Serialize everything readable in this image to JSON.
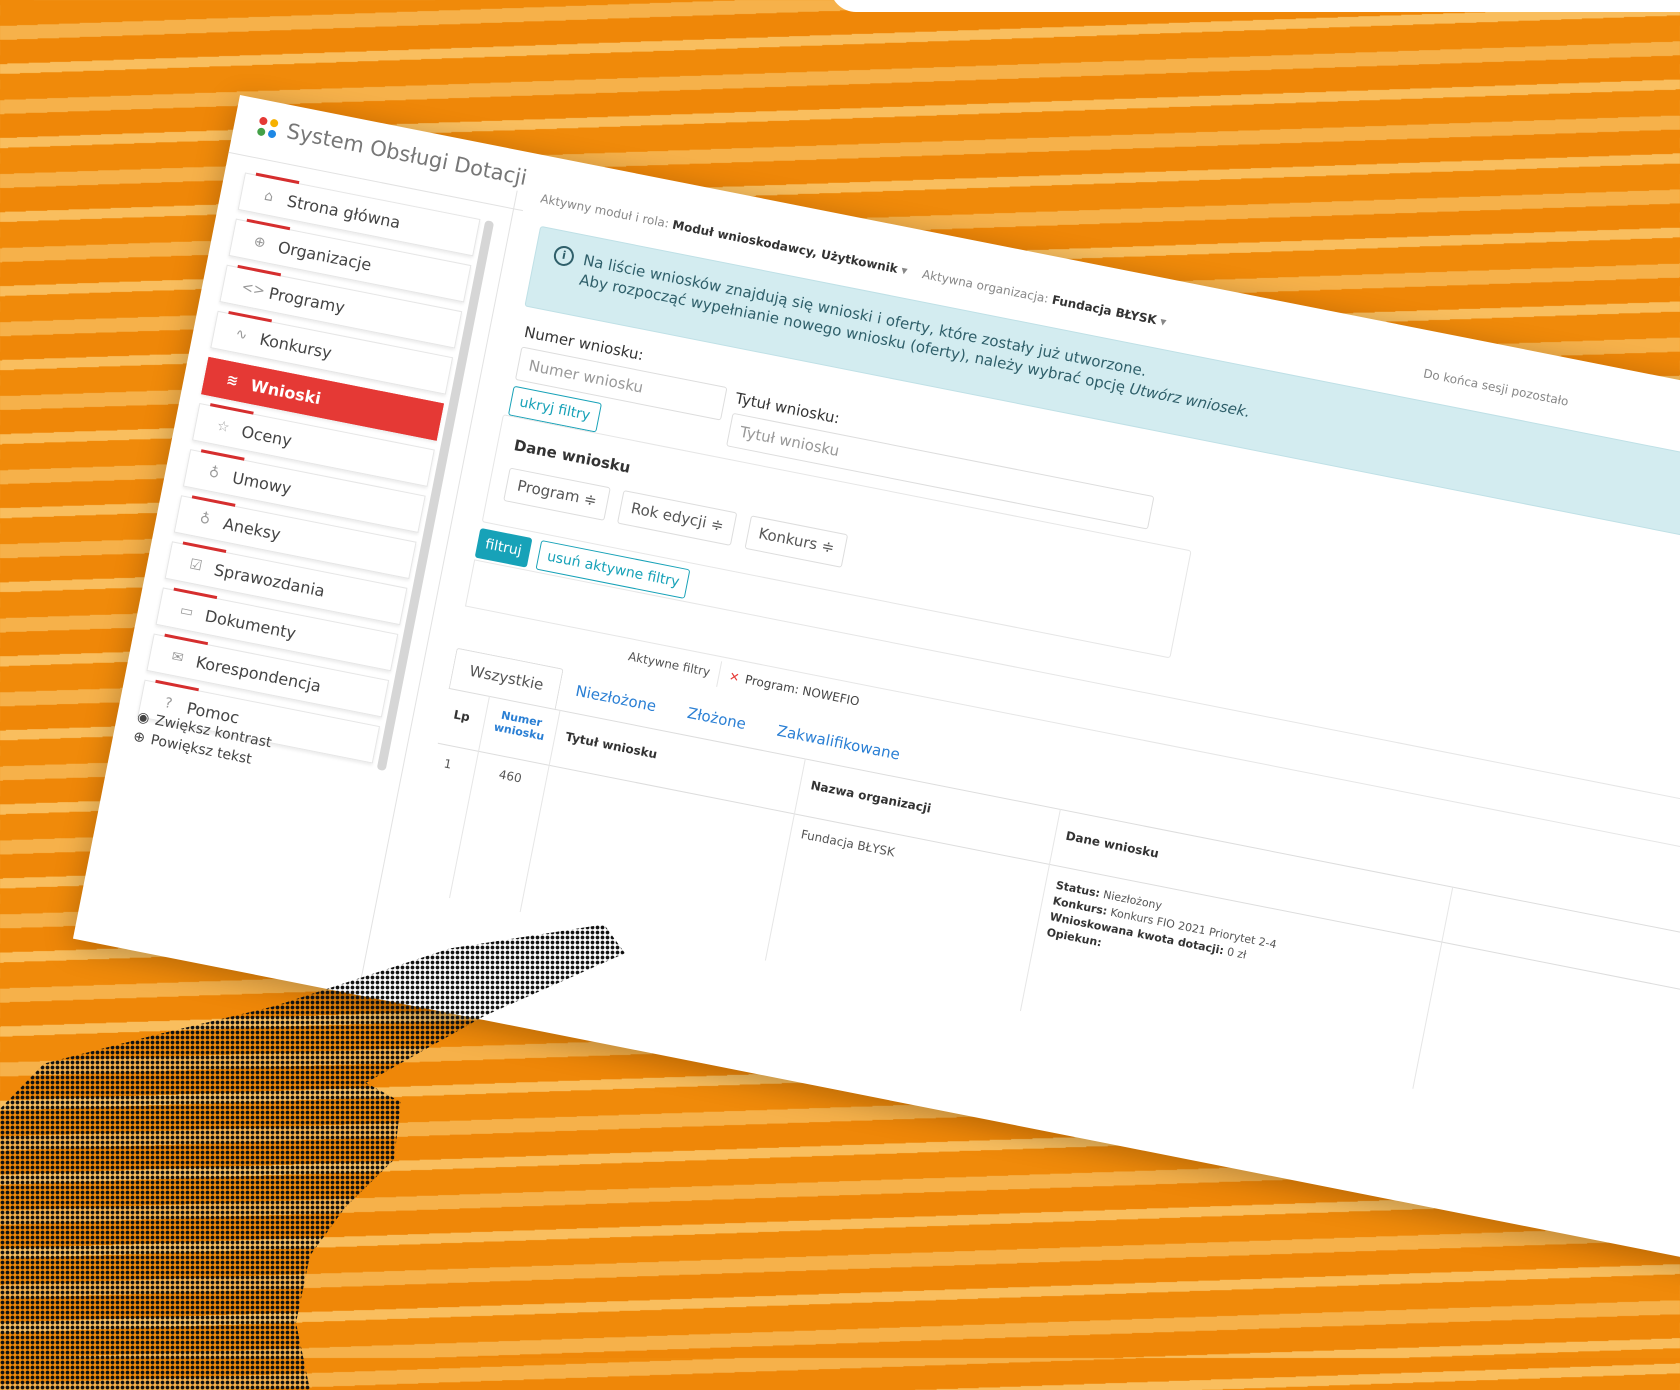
{
  "app": {
    "title": "System Obsługi Dotacji",
    "logo_colors": [
      "#e53935",
      "#f6b100",
      "#43a047",
      "#1e88e5"
    ]
  },
  "context": {
    "module_label": "Aktywny moduł i rola:",
    "module_value": "Moduł wnioskodawcy, Użytkownik",
    "org_label": "Aktywna organizacja:",
    "org_value": "Fundacja BŁYSK",
    "session_text": "Do końca sesji pozostało"
  },
  "sidebar": {
    "items": [
      {
        "label": "Strona główna",
        "icon": "home-icon",
        "glyph": "⌂"
      },
      {
        "label": "Organizacje",
        "icon": "globe-icon",
        "glyph": "⊕"
      },
      {
        "label": "Programy",
        "icon": "code-icon",
        "glyph": "<>"
      },
      {
        "label": "Konkursy",
        "icon": "pulse-icon",
        "glyph": "∿"
      },
      {
        "label": "Wnioski",
        "icon": "layers-icon",
        "glyph": "≋"
      },
      {
        "label": "Oceny",
        "icon": "star-icon",
        "glyph": "☆"
      },
      {
        "label": "Umowy",
        "icon": "award-icon",
        "glyph": "♁"
      },
      {
        "label": "Aneksy",
        "icon": "badge-icon",
        "glyph": "♁"
      },
      {
        "label": "Sprawozdania",
        "icon": "checklist-icon",
        "glyph": "☑"
      },
      {
        "label": "Dokumenty",
        "icon": "folder-icon",
        "glyph": "▭"
      },
      {
        "label": "Korespondencja",
        "icon": "mail-icon",
        "glyph": "✉"
      },
      {
        "label": "Pomoc",
        "icon": "help-icon",
        "glyph": "?"
      }
    ],
    "active": "Wnioski",
    "accessibility": {
      "contrast": "Zwiększ kontrast",
      "text_size": "Powiększ tekst"
    }
  },
  "alert": {
    "line1": "Na liście wniosków znajdują się wnioski i oferty, które zostały już utworzone.",
    "line2_prefix": "Aby rozpocząć wypełnianie nowego wniosku (oferty), należy wybrać opcję ",
    "line2_emph": "Utwórz wniosek."
  },
  "filters": {
    "number_label": "Numer wniosku:",
    "number_placeholder": "Numer wniosku",
    "title_label": "Tytuł wniosku:",
    "title_placeholder": "Tytuł wniosku",
    "hide_filters": "ukryj filtry",
    "panel_title": "Dane wniosku",
    "selects": [
      "Program ≑",
      "Rok edycji ≑",
      "Konkurs ≑"
    ],
    "apply": "filtruj",
    "clear": "usuń aktywne filtry",
    "active_label": "Aktywne filtry",
    "active_chip": "Program: NOWEFIO"
  },
  "tabs": [
    "Wszystkie",
    "Niezłożone",
    "Złożone",
    "Zakwalifikowane"
  ],
  "table": {
    "headers": {
      "lp": "Lp",
      "numer": "Numer wniosku",
      "tytul": "Tytuł wniosku",
      "organizacja": "Nazwa organizacji",
      "dane": "Dane wniosku"
    },
    "rows": [
      {
        "lp": "1",
        "numer": "460",
        "tytul": "",
        "organizacja": "Fundacja BŁYSK",
        "status_label": "Status:",
        "status": "Niezłożony",
        "konkurs_label": "Konkurs:",
        "konkurs": "Konkurs FIO 2021 Priorytet 2-4",
        "kwota_label": "Wnioskowana kwota dotacji:",
        "kwota": "0 zł",
        "opiekun_label": "Opiekun:",
        "opiekun": ""
      }
    ]
  },
  "colors": {
    "accent": "#e53935",
    "teal": "#17a2b8",
    "link": "#2a7fd4",
    "alert_bg": "#d3ecf0",
    "background": "#f08a0a"
  }
}
